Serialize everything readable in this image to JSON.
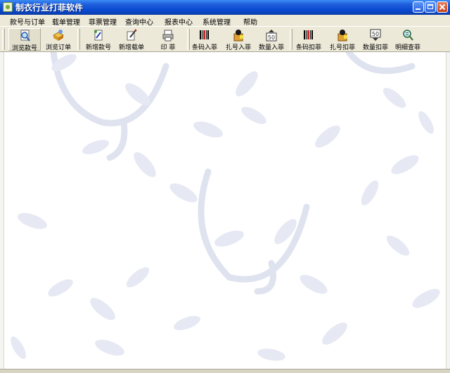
{
  "window": {
    "title": "制衣行业打菲软件"
  },
  "menu": [
    "款号与订单",
    "载单管理",
    "菲票管理",
    "查询中心",
    "报表中心",
    "系统管理",
    "帮助"
  ],
  "toolbar": [
    {
      "label": "浏览款号",
      "icon": "magnifier-document-icon"
    },
    {
      "label": "浏览订单",
      "icon": "order-box-icon"
    },
    {
      "label": "新增款号",
      "icon": "new-style-icon"
    },
    {
      "label": "新增载单",
      "icon": "new-cut-order-icon"
    },
    {
      "label": "印 菲",
      "icon": "print-ticket-icon"
    },
    {
      "label": "条码入菲",
      "icon": "barcode-in-icon"
    },
    {
      "label": "扎号入菲",
      "icon": "bundle-in-icon"
    },
    {
      "label": "数量入菲",
      "icon": "quantity-in-icon"
    },
    {
      "label": "条码扣菲",
      "icon": "barcode-deduct-icon"
    },
    {
      "label": "扎号扣菲",
      "icon": "bundle-deduct-icon"
    },
    {
      "label": "数量扣菲",
      "icon": "quantity-deduct-icon"
    },
    {
      "label": "明细查菲",
      "icon": "detail-search-icon"
    }
  ],
  "colors": {
    "title_bar": "#0b4ad2",
    "chrome": "#ece9d8",
    "watermark": "#dfe3ef"
  }
}
